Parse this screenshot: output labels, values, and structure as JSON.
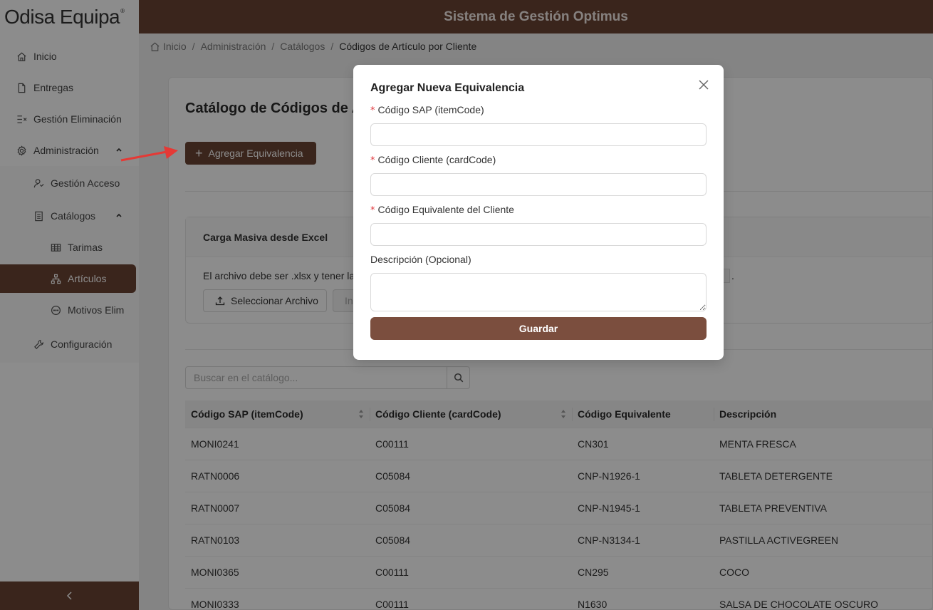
{
  "sidebar": {
    "logo": "Odisa Equipa",
    "logo_mark": "®",
    "items": [
      {
        "label": "Inicio",
        "icon": "home-icon"
      },
      {
        "label": "Entregas",
        "icon": "file-icon"
      },
      {
        "label": "Gestión Eliminación",
        "icon": "list-delete-icon"
      },
      {
        "label": "Administración",
        "icon": "gear-icon"
      }
    ],
    "admin_sub": [
      {
        "label": "Gestión Acceso",
        "icon": "user-access-icon"
      },
      {
        "label": "Catálogos",
        "icon": "book-icon"
      }
    ],
    "catalog_sub": [
      {
        "label": "Tarimas",
        "icon": "table-icon"
      },
      {
        "label": "Artículos",
        "icon": "hierarchy-icon"
      },
      {
        "label": "Motivos Elim",
        "icon": "message-icon"
      }
    ],
    "config": {
      "label": "Configuración",
      "icon": "tool-icon"
    },
    "collapse": "<"
  },
  "header": {
    "title": "Sistema de Gestión Optimus"
  },
  "breadcrumb": [
    "Inicio",
    "Administración",
    "Catálogos",
    "Códigos de Artículo por Cliente"
  ],
  "main": {
    "title": "Catálogo de Códigos de A",
    "add_button": "Agregar Equivalencia",
    "bulk": {
      "title": "Carga Masiva desde Excel",
      "text": "El archivo debe ser .xlsx y tener las",
      "tail": ".",
      "select_button": "Seleccionar Archivo",
      "import_button": "In"
    },
    "search": {
      "placeholder": "Buscar en el catálogo..."
    },
    "table": {
      "headers": [
        "Código SAP (itemCode)",
        "Código Cliente (cardCode)",
        "Código Equivalente",
        "Descripción"
      ],
      "rows": [
        [
          "MONI0241",
          "C00111",
          "CN301",
          "MENTA FRESCA"
        ],
        [
          "RATN0006",
          "C05084",
          "CNP-N1926-1",
          "TABLETA DETERGENTE"
        ],
        [
          "RATN0007",
          "C05084",
          "CNP-N1945-1",
          "TABLETA PREVENTIVA"
        ],
        [
          "RATN0103",
          "C05084",
          "CNP-N3134-1",
          "PASTILLA ACTIVEGREEN"
        ],
        [
          "MONI0365",
          "C00111",
          "CN295",
          "COCO"
        ],
        [
          "MONI0333",
          "C00111",
          "N1630",
          "SALSA DE CHOCOLATE OSCURO"
        ]
      ]
    }
  },
  "modal": {
    "title": "Agregar Nueva Equivalencia",
    "required_mark": "*",
    "fields": [
      {
        "label": "Código SAP (itemCode)",
        "value": ""
      },
      {
        "label": "Código Cliente (cardCode)",
        "value": ""
      },
      {
        "label": "Código Equivalente del Cliente",
        "value": ""
      }
    ],
    "description_label": "Descripción (Opcional)",
    "save_button": "Guardar"
  },
  "colors": {
    "brand": "#6b4434",
    "save": "#7b4e3e",
    "required": "#e0393e",
    "arrow": "#e53935"
  }
}
